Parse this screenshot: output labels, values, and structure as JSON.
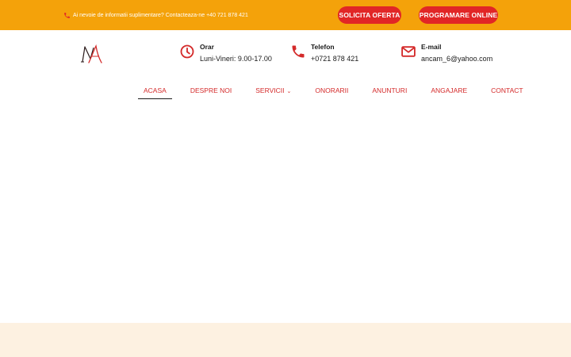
{
  "topbar": {
    "message": "Ai nevoie de informatii suplimentare? Contacteaza-ne +40 721 878 421",
    "buttons": {
      "offer": "SOLICITA OFERTA",
      "booking": "PROGRAMARE ONLINE"
    }
  },
  "header": {
    "hours": {
      "label": "Orar",
      "value": "Luni-Vineri: 9.00-17.00",
      "icon": "clock-icon"
    },
    "phone": {
      "label": "Telefon",
      "value": "+0721 878 421",
      "icon": "phone-icon"
    },
    "email": {
      "label": "E-mail",
      "value": "ancam_6@yahoo.com",
      "icon": "envelope-icon"
    }
  },
  "nav": {
    "items": [
      {
        "label": "ACASA"
      },
      {
        "label": "DESPRE NOI"
      },
      {
        "label": "SERVICII"
      },
      {
        "label": "ONORARII"
      },
      {
        "label": "ANUNTURI"
      },
      {
        "label": "ANGAJARE"
      },
      {
        "label": "CONTACT"
      }
    ]
  },
  "colors": {
    "topbar": "#f4a20a",
    "accent": "#e12626",
    "footer_band": "#fdf1e1"
  }
}
